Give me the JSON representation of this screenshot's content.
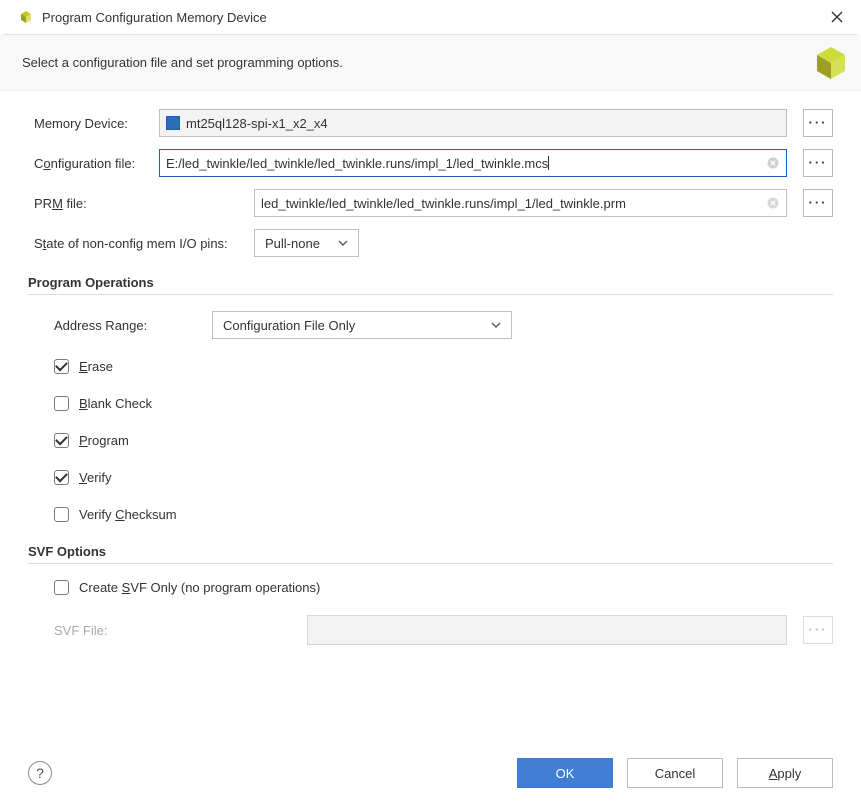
{
  "title": "Program Configuration Memory Device",
  "banner": "Select a configuration file and set programming options.",
  "labels": {
    "memory_device": "Memory Device:",
    "config_file_pre": "C",
    "config_file_u": "o",
    "config_file_post": "nfiguration file:",
    "prm_pre": "PR",
    "prm_u": "M",
    "prm_post": " file:",
    "state_pre": "S",
    "state_u": "t",
    "state_post": "ate of non-config mem I/O pins:",
    "address_range": "Address Range:",
    "svf_file": "SVF File:"
  },
  "fields": {
    "memory_device": "mt25ql128-spi-x1_x2_x4",
    "config_file": "E:/led_twinkle/led_twinkle/led_twinkle.runs/impl_1/led_twinkle.mcs",
    "prm_file": "led_twinkle/led_twinkle/led_twinkle.runs/impl_1/led_twinkle.prm",
    "io_state": "Pull-none",
    "address_range_value": "Configuration File Only"
  },
  "sections": {
    "program_ops": "Program Operations",
    "svf_options": "SVF Options"
  },
  "ops": {
    "erase_u": "E",
    "erase_post": "rase",
    "blank_u": "B",
    "blank_post": "lank Check",
    "program_u": "P",
    "program_post": "rogram",
    "verify_u": "V",
    "verify_post": "erify",
    "vchk_pre": "Verify ",
    "vchk_u": "C",
    "vchk_post": "hecksum",
    "svf_pre": "Create ",
    "svf_u": "S",
    "svf_post": "VF Only (no program operations)"
  },
  "buttons": {
    "ok": "OK",
    "cancel": "Cancel",
    "apply_u": "A",
    "apply_post": "pply"
  }
}
